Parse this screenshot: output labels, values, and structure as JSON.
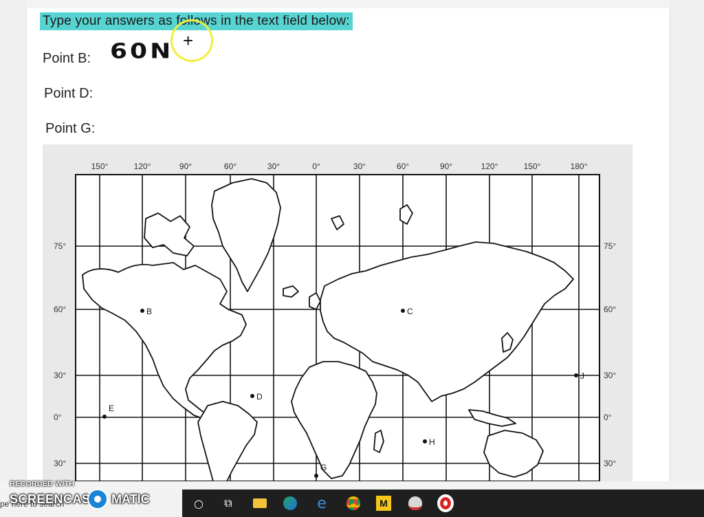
{
  "instruction": "Type your answers as follows in the text field below:",
  "points": [
    {
      "label": "Point B:"
    },
    {
      "label": "Point D:"
    },
    {
      "label": "Point G:"
    }
  ],
  "answer_b": "60N",
  "map": {
    "top_longitudes": [
      "150°",
      "120°",
      "90°",
      "60°",
      "30°",
      "0°",
      "30°",
      "60°",
      "90°",
      "120°",
      "150°",
      "180°"
    ],
    "left_latitudes": [
      "75°",
      "60°",
      "30°",
      "0°",
      "30°"
    ],
    "right_latitudes": [
      "75°",
      "60°",
      "30°",
      "0°",
      "30°"
    ],
    "point_labels": [
      "B",
      "C",
      "D",
      "E",
      "G",
      "H",
      "J"
    ]
  },
  "watermark": {
    "recorded_with": "RECORDED WITH",
    "screencast": "SCREENCAST",
    "matic": "MATIC"
  },
  "taskbar": {
    "search_placeholder": "pe here to search",
    "icons": [
      "cortana-icon",
      "task-view-icon",
      "file-explorer-icon",
      "edge-icon",
      "ie-icon",
      "chrome-icon",
      "m-app-icon",
      "paint-icon",
      "record-icon"
    ]
  }
}
